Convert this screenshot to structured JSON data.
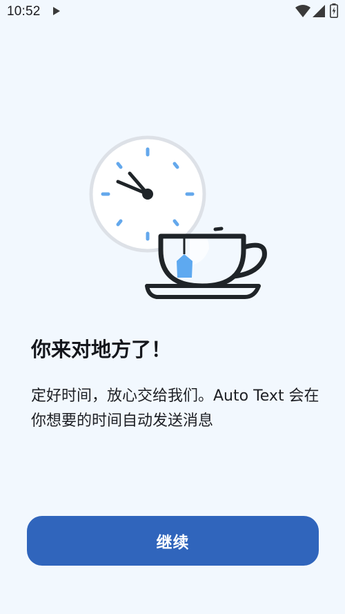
{
  "status_bar": {
    "time": "10:52",
    "icons": [
      "play-icon",
      "wifi-icon",
      "signal-icon",
      "battery-charging-icon"
    ]
  },
  "illustration": {
    "icons": [
      "clock-icon",
      "teacup-icon"
    ],
    "colors": {
      "clock_face": "#ffffff",
      "clock_rim": "#dde1e7",
      "tick_marks": "#64a8ec",
      "hands": "#1f2428",
      "tea_tag": "#5ea9f0",
      "cup_outline": "#1f2428"
    }
  },
  "content": {
    "title": "你来对地方了！",
    "description": "定好时间，放心交给我们。Auto Text 会在你想要的时间自动发送消息"
  },
  "actions": {
    "continue_label": "继续"
  },
  "theme": {
    "background": "#f2f8fe",
    "primary": "#3065bc",
    "on_primary": "#ffffff"
  }
}
